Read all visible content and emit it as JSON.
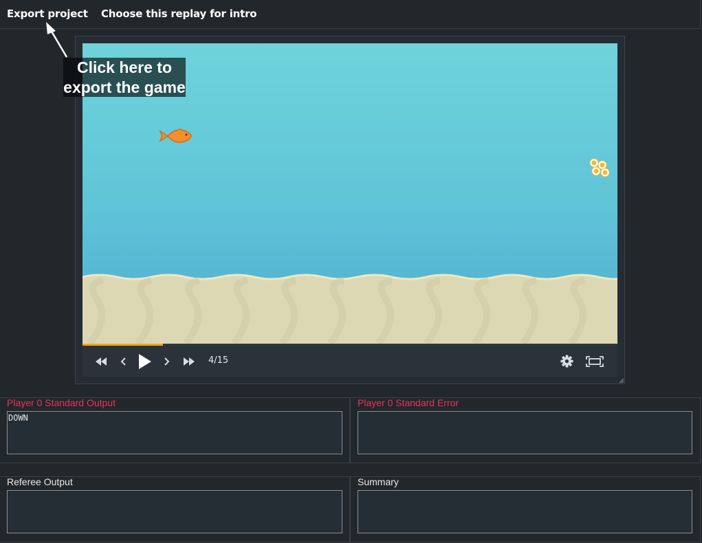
{
  "toolbar": {
    "export_label": "Export project",
    "intro_label": "Choose this replay for intro"
  },
  "tooltip": {
    "line1": "Click here to",
    "line2": "export the game"
  },
  "player": {
    "frame_counter": "4/15",
    "progress_fraction": 0.15
  },
  "panels": {
    "stdout": {
      "label": "Player 0 Standard Output",
      "content": "DOWN"
    },
    "stderr": {
      "label": "Player 0 Standard Error",
      "content": ""
    },
    "referee": {
      "label": "Referee Output",
      "content": ""
    },
    "summary": {
      "label": "Summary",
      "content": ""
    }
  },
  "colors": {
    "background": "#22272c",
    "accent_progress": "#f5a31a",
    "error_label": "#e8345a",
    "water_top": "#6ed3da",
    "sand": "#dcd8b4"
  },
  "icons": [
    "rewind-icon",
    "step-back-icon",
    "play-icon",
    "step-forward-icon",
    "fast-forward-icon",
    "gear-icon",
    "fullscreen-icon"
  ]
}
